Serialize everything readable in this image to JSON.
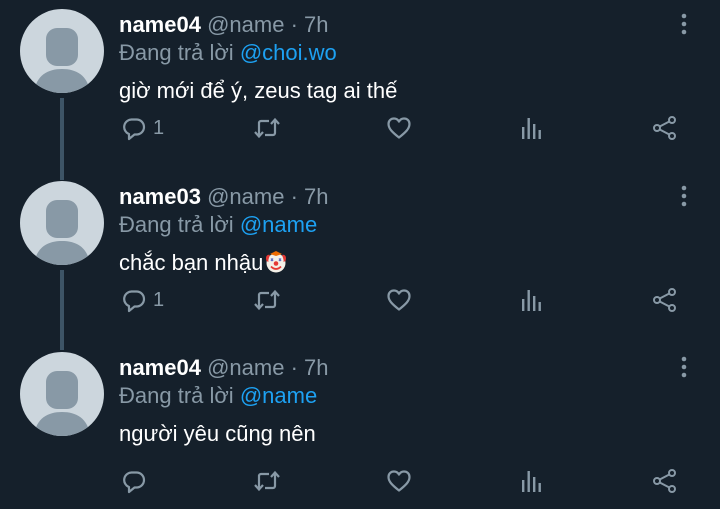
{
  "tweets": [
    {
      "name": "name04",
      "handle": "@name",
      "separator": "·",
      "time": "7h",
      "reply_prefix": "Đang trả lời",
      "reply_to": "@choi.wo",
      "text": "giờ mới để ý, zeus tag ai thế",
      "reply_count": "1"
    },
    {
      "name": "name03",
      "handle": "@name",
      "separator": "·",
      "time": "7h",
      "reply_prefix": "Đang trả lời",
      "reply_to": "@name",
      "text": "chắc bạn nhậu",
      "emoji": "clown-face-emoji",
      "reply_count": "1"
    },
    {
      "name": "name04",
      "handle": "@name",
      "separator": "·",
      "time": "7h",
      "reply_prefix": "Đang trả lời",
      "reply_to": "@name",
      "text": "người yêu cũng nên",
      "reply_count": ""
    }
  ],
  "icons": {
    "reply": "reply-icon",
    "retweet": "retweet-icon",
    "like": "heart-icon",
    "analytics": "analytics-icon",
    "share": "share-icon",
    "more": "more-vertical-icon"
  },
  "colors": {
    "background": "#15202b",
    "text_primary": "#ffffff",
    "text_secondary": "#8899a6",
    "accent": "#1da1f2",
    "thread_line": "#3d5466",
    "avatar": "#ccd6dd"
  }
}
